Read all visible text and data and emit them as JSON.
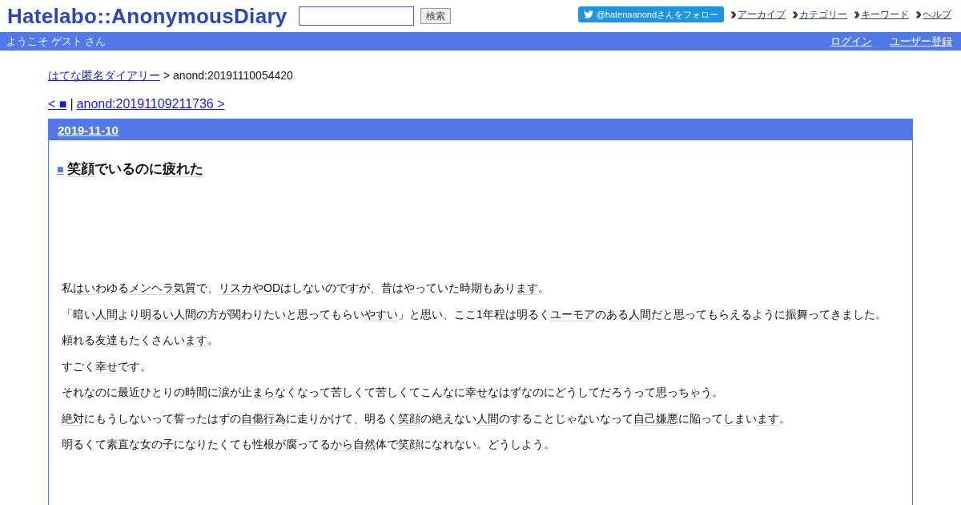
{
  "header": {
    "logo": "Hatelabo::AnonymousDiary",
    "search": {
      "button": "検索"
    },
    "follow_button": "@hatenaanondさんをフォロー",
    "nav_links": [
      "アーカイブ",
      "カテゴリー",
      "キーワード",
      "ヘルプ"
    ]
  },
  "user_bar": {
    "greeting": "ようこそ ゲスト さん",
    "links": [
      "ログイン",
      "ユーザー登録"
    ]
  },
  "breadcrumb": {
    "link": "はてな匿名ダイアリー",
    "current": "> anond:20191110054420"
  },
  "pager": {
    "prev": "< ■",
    "separator": "|",
    "next": "anond:20191109211736 >"
  },
  "day": {
    "date": "2019-11-10",
    "entry": {
      "mark": "■",
      "title": [
        {
          "kind": "keyword",
          "text": "笑顔"
        },
        {
          "kind": "text",
          "text": "でいるのに"
        },
        {
          "kind": "keyword",
          "text": "疲れた"
        }
      ],
      "paragraphs": [
        [
          {
            "kind": "text",
            "text": "私"
          },
          {
            "kind": "keyword",
            "text": "はい"
          },
          {
            "kind": "text",
            "text": "わゆる"
          },
          {
            "kind": "keyword",
            "text": "メンヘラ気質"
          },
          {
            "kind": "text",
            "text": "で、"
          },
          {
            "kind": "keyword",
            "text": "リスカ"
          },
          {
            "kind": "text",
            "text": "や"
          },
          {
            "kind": "keyword",
            "text": "OD"
          },
          {
            "kind": "text",
            "text": "はしないのですが、昔はやっていた時期もあり"
          },
          {
            "kind": "keyword",
            "text": "ます"
          },
          {
            "kind": "text",
            "text": "。"
          }
        ],
        [
          {
            "kind": "text",
            "text": "「暗い"
          },
          {
            "kind": "keyword",
            "text": "人間"
          },
          {
            "kind": "text",
            "text": "より"
          },
          {
            "kind": "keyword",
            "text": "明るい人間"
          },
          {
            "kind": "text",
            "text": "の方が関わりたいと思ってもらい"
          },
          {
            "kind": "keyword",
            "text": "やすい"
          },
          {
            "kind": "text",
            "text": "」と思い、ここ1年程は明るく"
          },
          {
            "kind": "keyword",
            "text": "ユーモア"
          },
          {
            "kind": "text",
            "text": "のある"
          },
          {
            "kind": "keyword",
            "text": "人間"
          },
          {
            "kind": "text",
            "text": "だと思ってもらえるように振舞ってきました。"
          }
        ],
        [
          {
            "kind": "text",
            "text": "頼れる"
          },
          {
            "kind": "keyword",
            "text": "友達"
          },
          {
            "kind": "text",
            "text": "もたくさんい"
          },
          {
            "kind": "keyword",
            "text": "ます"
          },
          {
            "kind": "text",
            "text": "。"
          }
        ],
        [
          {
            "kind": "text",
            "text": "すごく"
          },
          {
            "kind": "keyword",
            "text": "幸せ"
          },
          {
            "kind": "text",
            "text": "です。"
          }
        ],
        [
          {
            "kind": "text",
            "text": "それなのに"
          },
          {
            "kind": "keyword",
            "text": "最近"
          },
          {
            "kind": "text",
            "text": "ひとりの"
          },
          {
            "kind": "keyword",
            "text": "時間"
          },
          {
            "kind": "text",
            "text": "に涙が止"
          },
          {
            "kind": "keyword",
            "text": "まら"
          },
          {
            "kind": "text",
            "text": "なくなって苦しくて苦しくてこんなに"
          },
          {
            "kind": "keyword",
            "text": "幸せ"
          },
          {
            "kind": "text",
            "text": "なはずなのにどうしてだろうって思っ"
          },
          {
            "kind": "keyword",
            "text": "ちゃう"
          },
          {
            "kind": "text",
            "text": "。"
          }
        ],
        [
          {
            "kind": "keyword",
            "text": "絶対"
          },
          {
            "kind": "text",
            "text": "にもうしないって誓ったはずの"
          },
          {
            "kind": "keyword",
            "text": "自傷行為"
          },
          {
            "kind": "text",
            "text": "に走りかけて、明るく"
          },
          {
            "kind": "keyword",
            "text": "笑顔"
          },
          {
            "kind": "text",
            "text": "の絶えない"
          },
          {
            "kind": "keyword",
            "text": "人間"
          },
          {
            "kind": "text",
            "text": "のすることじゃないなって"
          },
          {
            "kind": "keyword",
            "text": "自己嫌悪"
          },
          {
            "kind": "text",
            "text": "に陥って"
          },
          {
            "kind": "keyword",
            "text": "しま"
          },
          {
            "kind": "text",
            "text": "い"
          },
          {
            "kind": "keyword",
            "text": "ます"
          },
          {
            "kind": "text",
            "text": "。"
          }
        ],
        [
          {
            "kind": "text",
            "text": "明るくて素直な"
          },
          {
            "kind": "keyword",
            "text": "女の子"
          },
          {
            "kind": "text",
            "text": "になりたくても性根が腐ってる"
          },
          {
            "kind": "keyword",
            "text": "から自然"
          },
          {
            "kind": "text",
            "text": "体で"
          },
          {
            "kind": "keyword",
            "text": "笑顔"
          },
          {
            "kind": "text",
            "text": "になれない。どうしよう。"
          }
        ]
      ]
    }
  }
}
